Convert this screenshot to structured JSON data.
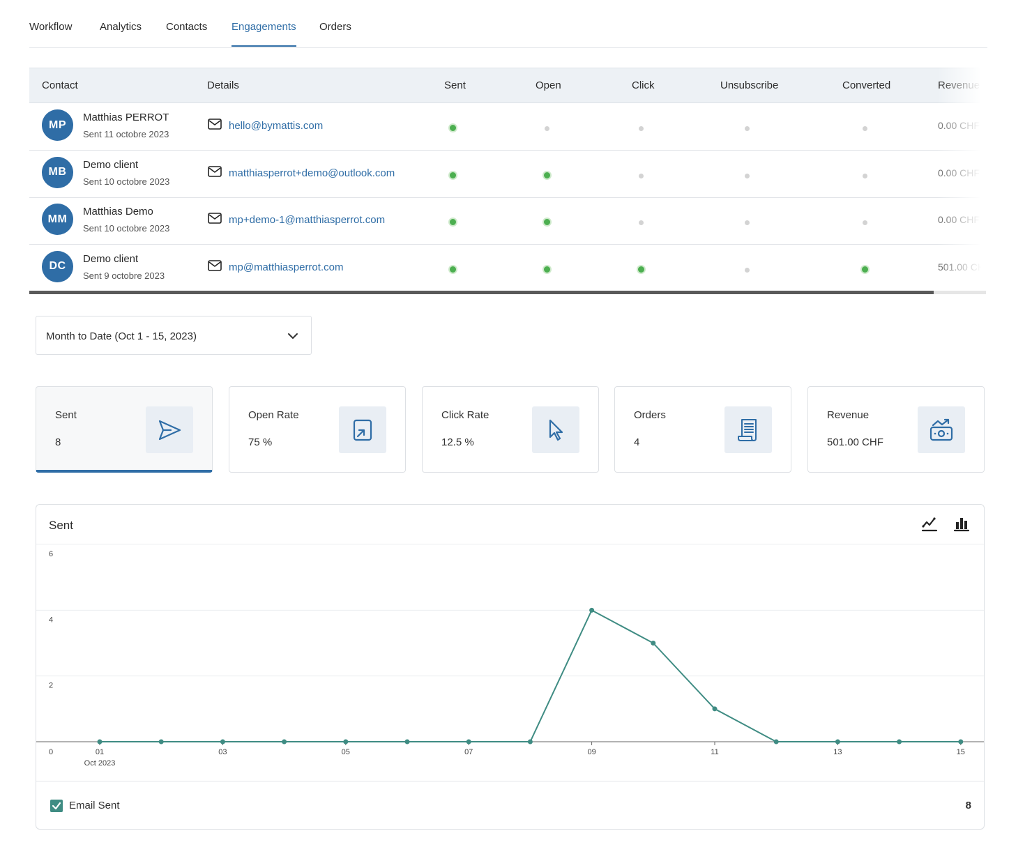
{
  "tabs": [
    {
      "label": "Workflow",
      "active": false
    },
    {
      "label": "Analytics",
      "active": false
    },
    {
      "label": "Contacts",
      "active": false
    },
    {
      "label": "Engagements",
      "active": true
    },
    {
      "label": "Orders",
      "active": false
    }
  ],
  "table": {
    "columns": [
      "Contact",
      "Details",
      "Sent",
      "Open",
      "Click",
      "Unsubscribe",
      "Converted",
      "Revenue"
    ],
    "rows": [
      {
        "initials": "MP",
        "name": "Matthias PERROT",
        "sent_date": "Sent 11 octobre 2023",
        "email": "hello@bymattis.com",
        "sent": true,
        "open": false,
        "click": false,
        "unsubscribe": false,
        "converted": false,
        "revenue": "0.00 CHF"
      },
      {
        "initials": "MB",
        "name": "Demo client",
        "sent_date": "Sent 10 octobre 2023",
        "email": "matthiasperrot+demo@outlook.com",
        "sent": true,
        "open": true,
        "click": false,
        "unsubscribe": false,
        "converted": false,
        "revenue": "0.00 CHF"
      },
      {
        "initials": "MM",
        "name": "Matthias Demo",
        "sent_date": "Sent 10 octobre 2023",
        "email": "mp+demo-1@matthiasperrot.com",
        "sent": true,
        "open": true,
        "click": false,
        "unsubscribe": false,
        "converted": false,
        "revenue": "0.00 CHF"
      },
      {
        "initials": "DC",
        "name": "Demo client",
        "sent_date": "Sent 9 octobre 2023",
        "email": "mp@matthiasperrot.com",
        "sent": true,
        "open": true,
        "click": true,
        "unsubscribe": false,
        "converted": true,
        "revenue": "501.00 CHF"
      }
    ]
  },
  "date_range": {
    "label": "Month to Date (Oct 1 - 15, 2023)"
  },
  "stats": [
    {
      "title": "Sent",
      "value": "8",
      "icon": "send-icon",
      "active": true
    },
    {
      "title": "Open Rate",
      "value": "75 %",
      "icon": "open-icon",
      "active": false
    },
    {
      "title": "Click Rate",
      "value": "12.5 %",
      "icon": "cursor-icon",
      "active": false
    },
    {
      "title": "Orders",
      "value": "4",
      "icon": "receipt-icon",
      "active": false
    },
    {
      "title": "Revenue",
      "value": "501.00 CHF",
      "icon": "money-icon",
      "active": false
    }
  ],
  "chart_panel": {
    "title": "Sent",
    "legend_label": "Email Sent",
    "legend_total": "8",
    "tools": [
      "line-chart-icon",
      "bar-chart-icon"
    ]
  },
  "colors": {
    "accent": "#2f6da6",
    "series": "#3f8c83",
    "dot_on": "#4caf50",
    "dot_off": "#d3d3d3"
  },
  "chart_data": {
    "type": "line",
    "x": [
      1,
      2,
      3,
      4,
      5,
      6,
      7,
      8,
      9,
      10,
      11,
      12,
      13,
      14,
      15
    ],
    "series": [
      {
        "name": "Email Sent",
        "values": [
          0,
          0,
          0,
          0,
          0,
          0,
          0,
          0,
          4,
          3,
          1,
          0,
          0,
          0,
          0
        ]
      }
    ],
    "x_tick_labels": [
      "01",
      "03",
      "05",
      "07",
      "09",
      "11",
      "13",
      "15"
    ],
    "x_tick_values": [
      1,
      3,
      5,
      7,
      9,
      11,
      13,
      15
    ],
    "x_sublabel": "Oct 2023",
    "y_ticks": [
      0,
      2,
      4,
      6
    ],
    "ylim": [
      0,
      6
    ],
    "xlim": [
      0,
      15.4
    ],
    "grid": true
  }
}
